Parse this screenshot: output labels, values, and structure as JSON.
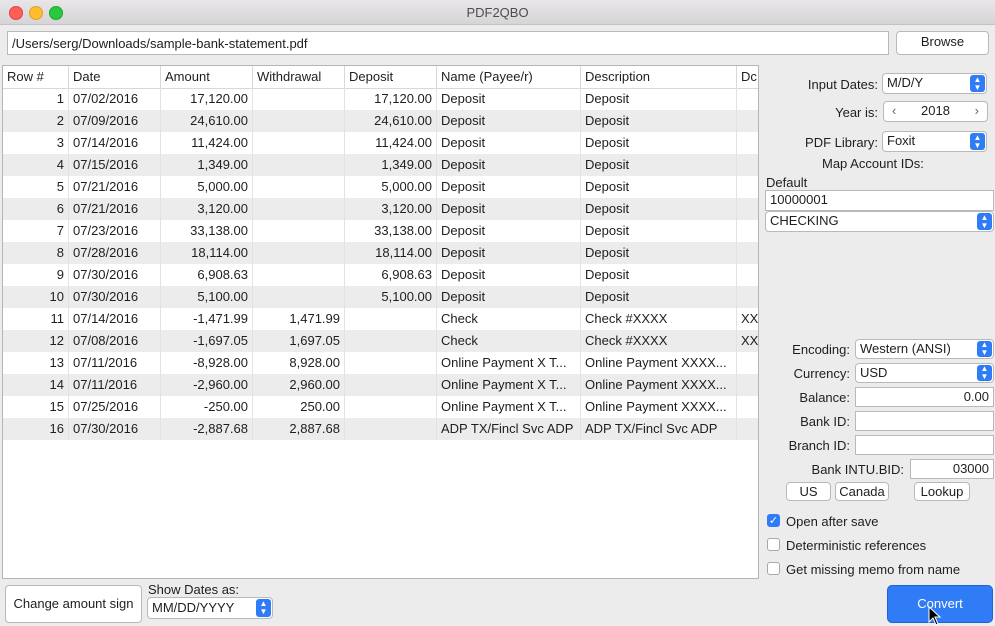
{
  "window": {
    "title": "PDF2QBO"
  },
  "file": {
    "path": "/Users/serg/Downloads/sample-bank-statement.pdf",
    "browse_label": "Browse"
  },
  "table": {
    "columns": [
      "Row #",
      "Date",
      "Amount",
      "Withdrawal",
      "Deposit",
      "Name (Payee/r)",
      "Description",
      "Dc"
    ],
    "rows": [
      [
        "1",
        "07/02/2016",
        "17,120.00",
        "",
        "17,120.00",
        "Deposit",
        "Deposit",
        ""
      ],
      [
        "2",
        "07/09/2016",
        "24,610.00",
        "",
        "24,610.00",
        "Deposit",
        "Deposit",
        ""
      ],
      [
        "3",
        "07/14/2016",
        "11,424.00",
        "",
        "11,424.00",
        "Deposit",
        "Deposit",
        ""
      ],
      [
        "4",
        "07/15/2016",
        "1,349.00",
        "",
        "1,349.00",
        "Deposit",
        "Deposit",
        ""
      ],
      [
        "5",
        "07/21/2016",
        "5,000.00",
        "",
        "5,000.00",
        "Deposit",
        "Deposit",
        ""
      ],
      [
        "6",
        "07/21/2016",
        "3,120.00",
        "",
        "3,120.00",
        "Deposit",
        "Deposit",
        ""
      ],
      [
        "7",
        "07/23/2016",
        "33,138.00",
        "",
        "33,138.00",
        "Deposit",
        "Deposit",
        ""
      ],
      [
        "8",
        "07/28/2016",
        "18,114.00",
        "",
        "18,114.00",
        "Deposit",
        "Deposit",
        ""
      ],
      [
        "9",
        "07/30/2016",
        "6,908.63",
        "",
        "6,908.63",
        "Deposit",
        "Deposit",
        ""
      ],
      [
        "10",
        "07/30/2016",
        "5,100.00",
        "",
        "5,100.00",
        "Deposit",
        "Deposit",
        ""
      ],
      [
        "11",
        "07/14/2016",
        "-1,471.99",
        "1,471.99",
        "",
        "Check",
        "Check #XXXX",
        "XX"
      ],
      [
        "12",
        "07/08/2016",
        "-1,697.05",
        "1,697.05",
        "",
        "Check",
        "Check #XXXX",
        "XX"
      ],
      [
        "13",
        "07/11/2016",
        "-8,928.00",
        "8,928.00",
        "",
        "Online Payment X T...",
        "Online Payment XXXX...",
        ""
      ],
      [
        "14",
        "07/11/2016",
        "-2,960.00",
        "2,960.00",
        "",
        "Online Payment X T...",
        "Online Payment XXXX...",
        ""
      ],
      [
        "15",
        "07/25/2016",
        "-250.00",
        "250.00",
        "",
        "Online Payment X T...",
        "Online Payment XXXX...",
        ""
      ],
      [
        "16",
        "07/30/2016",
        "-2,887.68",
        "2,887.68",
        "",
        "ADP TX/Fincl Svc ADP",
        "ADP TX/Fincl Svc ADP",
        ""
      ]
    ]
  },
  "bottom": {
    "change_sign_label": "Change amount sign",
    "show_dates_label": "Show Dates as:",
    "show_dates_value": "MM/DD/YYYY"
  },
  "settings": {
    "input_dates_label": "Input Dates:",
    "input_dates_value": "M/D/Y",
    "year_label": "Year is:",
    "year_value": "2018",
    "pdf_library_label": "PDF Library:",
    "pdf_library_value": "Foxit",
    "map_accounts_label": "Map Account IDs:",
    "default_label": "Default",
    "account_id_value": "10000001",
    "account_type_value": "CHECKING",
    "encoding_label": "Encoding:",
    "encoding_value": "Western (ANSI)",
    "currency_label": "Currency:",
    "currency_value": "USD",
    "balance_label": "Balance:",
    "balance_value": "0.00",
    "bank_id_label": "Bank ID:",
    "bank_id_value": "",
    "branch_id_label": "Branch ID:",
    "branch_id_value": "",
    "intu_bid_label": "Bank INTU.BID:",
    "intu_bid_value": "03000",
    "us_label": "US",
    "canada_label": "Canada",
    "lookup_label": "Lookup",
    "open_after_save_label": "Open after save",
    "open_after_save_checked": true,
    "deterministic_label": "Deterministic references",
    "deterministic_checked": false,
    "missing_memo_label": "Get missing memo from name",
    "missing_memo_checked": false,
    "convert_label": "Convert"
  },
  "colors": {
    "accent": "#2f7cf6",
    "close": "#fe5f57",
    "minimize": "#febc2e",
    "maximize": "#28c840"
  }
}
